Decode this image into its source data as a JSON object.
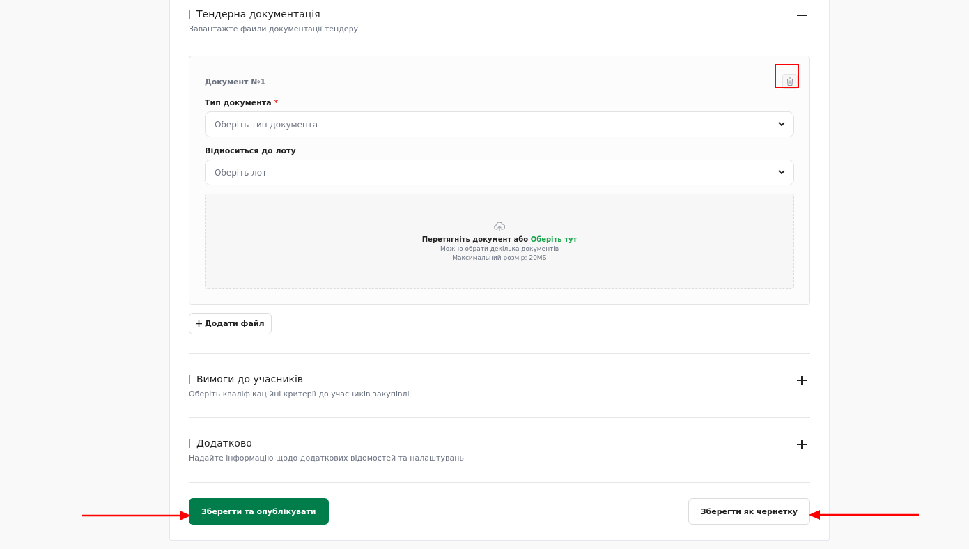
{
  "sections": [
    {
      "title": "Тендерна документація",
      "subtitle": "Завантажте файли документації тендеру",
      "expanded": true,
      "documents": [
        {
          "title": "Документ №1",
          "fields": [
            {
              "label": "Тип документа",
              "required_mark": "*",
              "placeholder": "Оберіть тип документа"
            },
            {
              "label": "Відноситься до лоту",
              "placeholder": "Оберіть лот"
            }
          ],
          "dropzone": {
            "text": "Перетягніть документ або ",
            "link": "Оберіть тут",
            "hint": "Можно обрати декілька документів",
            "max_size": "Максимальний розмір: 20МБ"
          }
        }
      ],
      "add_button": "Додати файл"
    },
    {
      "title": "Вимоги до учасників",
      "subtitle": "Оберіть кваліфікаційні критерії до учасників закупівлі",
      "expanded": false
    },
    {
      "title": "Додатково",
      "subtitle": "Надайте інформацію щодо додаткових відомостей та налаштувань",
      "expanded": false
    }
  ],
  "actions": {
    "publish": "Зберегти та опублікувати",
    "draft": "Зберегти як чернетку"
  }
}
